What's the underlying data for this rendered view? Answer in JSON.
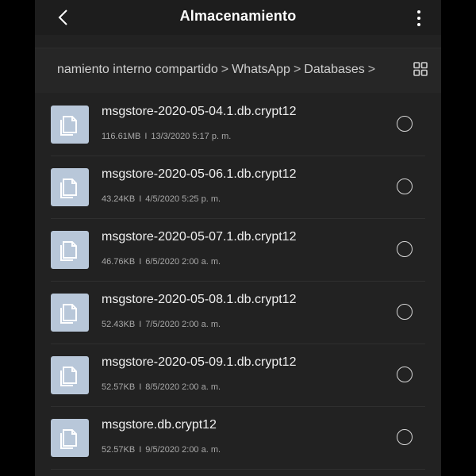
{
  "header": {
    "title": "Almacenamiento",
    "back_icon": "chevron-left-icon",
    "menu_icon": "more-vert-icon"
  },
  "breadcrumb": {
    "items": [
      "namiento interno compartido",
      "WhatsApp",
      "Databases"
    ],
    "separator": ">",
    "view_icon": "grid-view-icon"
  },
  "files": [
    {
      "name": "msgstore-2020-05-04.1.db.crypt12",
      "size": "116.61MB",
      "date": "13/3/2020 5:17 p. m."
    },
    {
      "name": "msgstore-2020-05-06.1.db.crypt12",
      "size": "43.24KB",
      "date": "4/5/2020 5:25 p. m."
    },
    {
      "name": "msgstore-2020-05-07.1.db.crypt12",
      "size": "46.76KB",
      "date": "6/5/2020 2:00 a. m."
    },
    {
      "name": "msgstore-2020-05-08.1.db.crypt12",
      "size": "52.43KB",
      "date": "7/5/2020 2:00 a. m."
    },
    {
      "name": "msgstore-2020-05-09.1.db.crypt12",
      "size": "52.57KB",
      "date": "8/5/2020 2:00 a. m."
    },
    {
      "name": "msgstore.db.crypt12",
      "size": "52.57KB",
      "date": "9/5/2020 2:00 a. m."
    }
  ],
  "meta_separator": "I",
  "colors": {
    "background": "#222222",
    "icon_tile": "#b8c7d9",
    "text_primary": "#f0f0f0",
    "text_secondary": "#a8a8a8"
  }
}
